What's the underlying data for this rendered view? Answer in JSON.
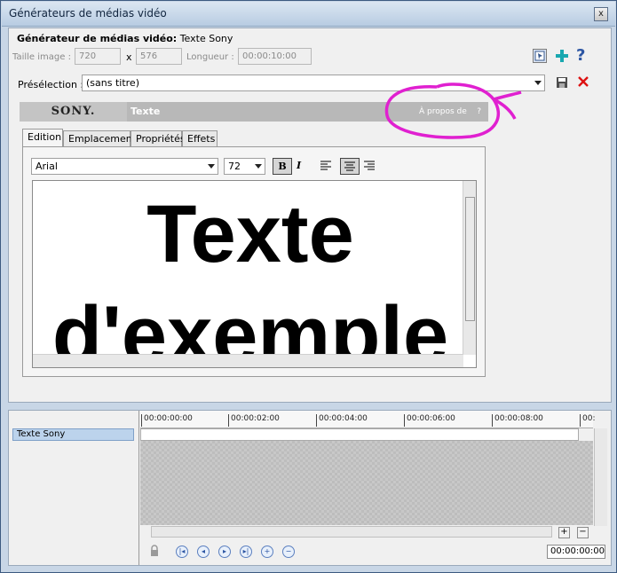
{
  "window": {
    "title": "Générateurs de médias vidéo",
    "close_glyph": "x"
  },
  "generator": {
    "heading_label": "Générateur de médias vidéo:",
    "heading_value": "Texte Sony"
  },
  "image_size": {
    "label": "Taille image :",
    "width": "720",
    "x": "x",
    "height": "576"
  },
  "length": {
    "label": "Longueur :",
    "value": "00:00:10:00"
  },
  "preset": {
    "label": "Présélection :",
    "value": "(sans titre)"
  },
  "sony_bar": {
    "logo": "SONY.",
    "plugin": "Texte",
    "about": "À propos de",
    "help": "?"
  },
  "tabs": [
    "Edition",
    "Emplacement",
    "Propriétés",
    "Effets"
  ],
  "format": {
    "font": "Arial",
    "size": "72",
    "bold": "B",
    "italic": "I"
  },
  "editor": {
    "line1": "Texte",
    "line2": "d'exemple"
  },
  "timeline": {
    "track": "Texte Sony",
    "ticks": [
      "00:00:00:00",
      "00:00:02:00",
      "00:00:04:00",
      "00:00:06:00",
      "00:00:08:00",
      "00:"
    ],
    "time": "00:00:00:00"
  },
  "colors": {
    "annotation_circle": "#e020d0",
    "accent": "#2d56a3"
  }
}
